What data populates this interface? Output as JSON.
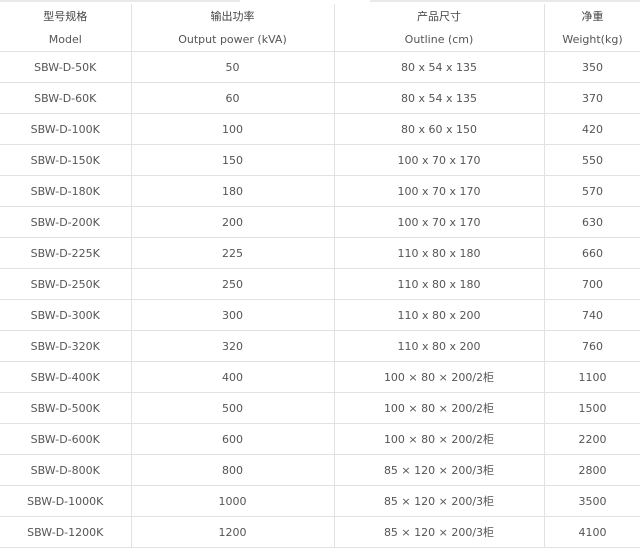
{
  "table": {
    "headers": [
      {
        "zh": "型号规格",
        "en": "Model"
      },
      {
        "zh": "输出功率",
        "en": "Output power (kVA)"
      },
      {
        "zh": "产品尺寸",
        "en": "Outline (cm)"
      },
      {
        "zh": "净重",
        "en": "Weight(kg)"
      }
    ],
    "rows": [
      [
        "SBW-D-50K",
        "50",
        "80 x 54 x 135",
        "350"
      ],
      [
        "SBW-D-60K",
        "60",
        "80 x 54 x 135",
        "370"
      ],
      [
        "SBW-D-100K",
        "100",
        "80 x 60 x 150",
        "420"
      ],
      [
        "SBW-D-150K",
        "150",
        "100 x 70 x 170",
        "550"
      ],
      [
        "SBW-D-180K",
        "180",
        "100 x 70 x 170",
        "570"
      ],
      [
        "SBW-D-200K",
        "200",
        "100 x 70 x 170",
        "630"
      ],
      [
        "SBW-D-225K",
        "225",
        "110 x 80 x 180",
        "660"
      ],
      [
        "SBW-D-250K",
        "250",
        "110 x 80 x 180",
        "700"
      ],
      [
        "SBW-D-300K",
        "300",
        "110 x 80 x 200",
        "740"
      ],
      [
        "SBW-D-320K",
        "320",
        "110 x 80 x 200",
        "760"
      ],
      [
        "SBW-D-400K",
        "400",
        "100 × 80 × 200/2柜",
        "1100"
      ],
      [
        "SBW-D-500K",
        "500",
        "100 × 80 × 200/2柜",
        "1500"
      ],
      [
        "SBW-D-600K",
        "600",
        "100 × 80 × 200/2柜",
        "2200"
      ],
      [
        "SBW-D-800K",
        "800",
        "85 × 120 × 200/3柜",
        "2800"
      ],
      [
        "SBW-D-1000K",
        "1000",
        "85 × 120 × 200/3柜",
        "3500"
      ],
      [
        "SBW-D-1200K",
        "1200",
        "85 × 120 × 200/3柜",
        "4100"
      ]
    ]
  }
}
